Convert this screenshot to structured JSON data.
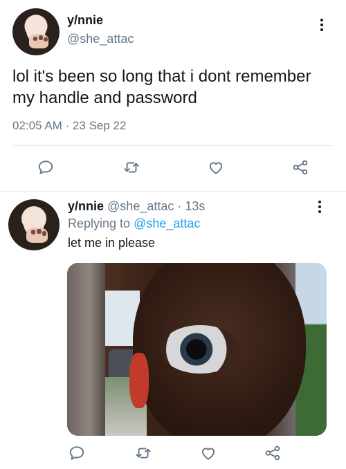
{
  "main_tweet": {
    "display_name": "y/nnie",
    "handle": "@she_attac",
    "text": "lol it's been so long that i dont remember my handle and password",
    "timestamp": "02:05 AM · 23 Sep 22"
  },
  "reply_tweet": {
    "display_name": "y/nnie",
    "handle": "@she_attac",
    "time": "· 13s",
    "replying_prefix": "Replying to",
    "replying_handle": "@she_attac",
    "text": "let me in please"
  },
  "icons": {
    "reply": "reply-icon",
    "retweet": "retweet-icon",
    "like": "like-icon",
    "share": "share-icon",
    "more": "more-icon"
  },
  "colors": {
    "text": "#14171a",
    "secondary": "#657786",
    "link": "#1da1f2",
    "divider": "#e1e8ed"
  }
}
